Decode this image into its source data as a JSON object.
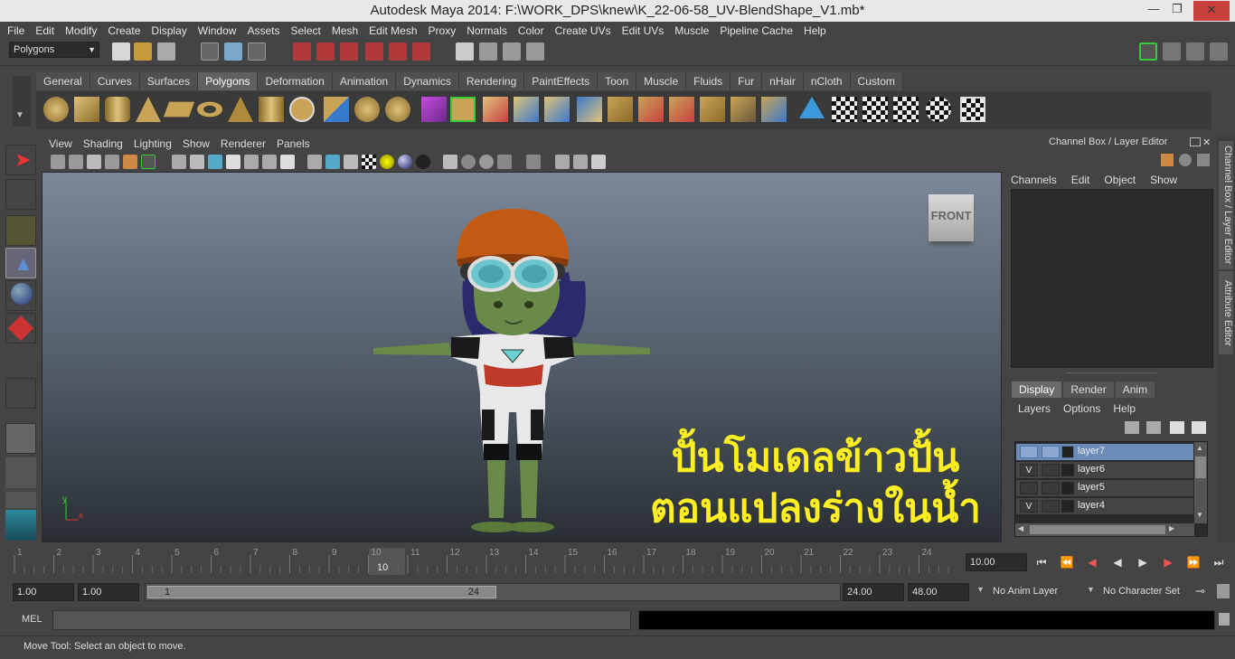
{
  "window": {
    "title": "Autodesk Maya 2014: F:\\WORK_DPS\\knew\\K_22-06-58_UV-BlendShape_V1.mb*"
  },
  "menubar": [
    "File",
    "Edit",
    "Modify",
    "Create",
    "Display",
    "Window",
    "Assets",
    "Select",
    "Mesh",
    "Edit Mesh",
    "Proxy",
    "Normals",
    "Color",
    "Create UVs",
    "Edit UVs",
    "Muscle",
    "Pipeline Cache",
    "Help"
  ],
  "statusline": {
    "menuset": "Polygons"
  },
  "shelf": {
    "tabs": [
      "General",
      "Curves",
      "Surfaces",
      "Polygons",
      "Deformation",
      "Animation",
      "Dynamics",
      "Rendering",
      "PaintEffects",
      "Toon",
      "Muscle",
      "Fluids",
      "Fur",
      "nHair",
      "nCloth",
      "Custom"
    ],
    "active_tab": "Polygons"
  },
  "viewport": {
    "menu": [
      "View",
      "Shading",
      "Lighting",
      "Show",
      "Renderer",
      "Panels"
    ],
    "viewcube_label": "FRONT",
    "overlay_text_line1": "ปั้นโมเดลข้าวปั้น",
    "overlay_text_line2": "ตอนแปลงร่างในน้ำ",
    "axis_y": "y",
    "axis_x": "x"
  },
  "channelbox": {
    "title": "Channel Box / Layer Editor",
    "menu": [
      "Channels",
      "Edit",
      "Object",
      "Show"
    ]
  },
  "layer_editor": {
    "tabs": [
      "Display",
      "Render",
      "Anim"
    ],
    "active_tab": "Display",
    "menu": [
      "Layers",
      "Options",
      "Help"
    ],
    "layers": [
      {
        "name": "layer7",
        "visible": "",
        "selected": true
      },
      {
        "name": "layer6",
        "visible": "V",
        "selected": false
      },
      {
        "name": "layer5",
        "visible": "",
        "selected": false
      },
      {
        "name": "layer4",
        "visible": "V",
        "selected": false
      }
    ]
  },
  "side_tabs": {
    "channel_box": "Channel Box / Layer Editor",
    "attribute_editor": "Attribute Editor"
  },
  "timeslider": {
    "ticks": [
      "1",
      "2",
      "3",
      "4",
      "5",
      "6",
      "7",
      "8",
      "9",
      "10",
      "11",
      "12",
      "13",
      "14",
      "15",
      "16",
      "17",
      "18",
      "19",
      "20",
      "21",
      "22",
      "23",
      "24"
    ],
    "current_frame": "10",
    "current_time_field": "10.00"
  },
  "range": {
    "start_time": "1.00",
    "playback_start": "1.00",
    "slider_start": "1",
    "slider_end": "24",
    "playback_end": "24.00",
    "end_time": "48.00",
    "anim_layer": "No Anim Layer",
    "character_set": "No Character Set"
  },
  "command_line": {
    "label": "MEL"
  },
  "help_line": {
    "text": "Move Tool: Select an object to move."
  }
}
